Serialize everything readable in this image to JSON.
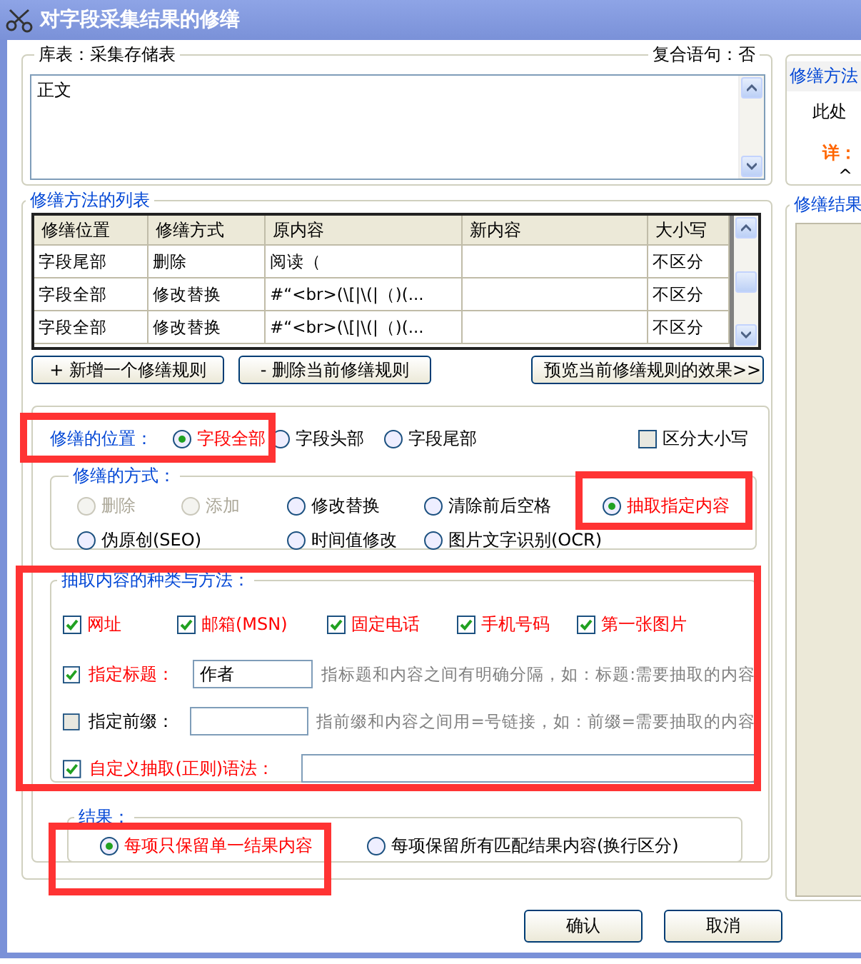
{
  "window": {
    "title": "对字段采集结果的修缮"
  },
  "source": {
    "table_label": "库表：采集存储表",
    "compound_label": "复合语句：否",
    "field_value": "正文"
  },
  "rules": {
    "title": "修缮方法的列表",
    "columns": [
      "修缮位置",
      "修缮方式",
      "原内容",
      "新内容",
      "大小写"
    ],
    "rows": [
      {
        "cells": [
          "字段尾部",
          "删除",
          "阅读（",
          "",
          "不区分"
        ]
      },
      {
        "cells": [
          "字段全部",
          "修改替换",
          "#“<br>(\\[|\\(|（)(...",
          "",
          "不区分"
        ]
      },
      {
        "cells": [
          "字段全部",
          "修改替换",
          "#“<br>(\\[|\\(|（)(...",
          "",
          "不区分"
        ]
      }
    ],
    "buttons": [
      "+ 新增一个修缮规则",
      "- 删除当前修缮规则",
      "预览当前修缮规则的效果>>"
    ]
  },
  "position": {
    "label": "修缮的位置：",
    "options": [
      {
        "label": "字段全部",
        "selected": true
      },
      {
        "label": "字段头部",
        "selected": false
      },
      {
        "label": "字段尾部",
        "selected": false
      }
    ],
    "case_sensitive": {
      "label": "区分大小写",
      "checked": false
    }
  },
  "method": {
    "title": "修缮的方式：",
    "options": [
      {
        "label": "删除",
        "selected": false,
        "disabled": true
      },
      {
        "label": "添加",
        "selected": false,
        "disabled": true
      },
      {
        "label": "修改替换",
        "selected": false,
        "disabled": false
      },
      {
        "label": "清除前后空格",
        "selected": false,
        "disabled": false
      },
      {
        "label": "抽取指定内容",
        "selected": true,
        "disabled": false
      },
      {
        "label": "伪原创(SEO)",
        "selected": false,
        "disabled": false
      },
      {
        "label": "时间值修改",
        "selected": false,
        "disabled": false
      },
      {
        "label": "图片文字识别(OCR)",
        "selected": false,
        "disabled": false
      }
    ]
  },
  "extract": {
    "title": "抽取内容的种类与方法：",
    "types": [
      {
        "label": "网址",
        "checked": true
      },
      {
        "label": "邮箱(MSN)",
        "checked": true
      },
      {
        "label": "固定电话",
        "checked": true
      },
      {
        "label": "手机号码",
        "checked": true
      },
      {
        "label": "第一张图片",
        "checked": true
      }
    ],
    "fields": [
      {
        "label": "指定标题：",
        "checked": true,
        "value": "作者",
        "hint": "指标题和内容之间有明确分隔，如：标题:需要抽取的内容"
      },
      {
        "label": "指定前缀：",
        "checked": false,
        "hint": "指前缀和内容之间用=号链接，如：前缀=需要抽取的内容"
      }
    ],
    "custom": {
      "label": "自定义抽取(正则)语法：",
      "checked": true
    }
  },
  "result": {
    "title": "结果：",
    "options": [
      {
        "label": "每项只保留单一结果内容",
        "selected": true
      },
      {
        "label": "每项保留所有匹配结果内容(换行区分)",
        "selected": false
      }
    ]
  },
  "buttons": [
    "确认",
    "取消"
  ],
  "side": {
    "title": "修缮方法",
    "text": "此处",
    "detail": "详：",
    "caret": "^",
    "result_title": "修缮结果"
  }
}
